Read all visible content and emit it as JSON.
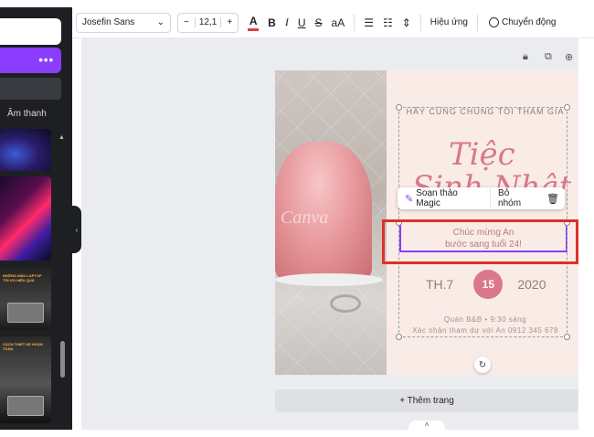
{
  "sidebar": {
    "more_label": "•••",
    "audio_label": "Âm thanh",
    "thumb3_text": "NHỮNG MẪU LAPTOP TỐI ƯU HIỆU QUẢ",
    "thumb4_text": "CÁCH THIẾT KẾ HOÀN TOÀN"
  },
  "toolbar": {
    "font_name": "Josefin Sans",
    "font_size": "12,1",
    "minus": "−",
    "plus": "+",
    "text_color_glyph": "A",
    "bold": "B",
    "italic": "I",
    "underline": "U",
    "strike": "S",
    "case": "aA",
    "effects": "Hiệu ứng",
    "animate": "Chuyển động",
    "text_color": "#e04040"
  },
  "design": {
    "watermark": "Canva",
    "invite_line": "HÃY CÙNG CHÚNG TÔI THAM GIA",
    "title_line1": "Tiệc",
    "title_line2": "Sinh Nhật",
    "congrats_line1": "Chúc mừng An",
    "congrats_line2": "bước sang tuổi 24!",
    "weekday": "TH.7",
    "day": "15",
    "year": "2020",
    "venue": "Quán B&B • 9:30 sáng",
    "rsvp": "Xác nhận tham dự với An 0912 345 678",
    "accent_color": "#d9788a"
  },
  "context_menu": {
    "magic_write": "Soạn thảo Magic",
    "ungroup": "Bỏ nhóm"
  },
  "footer": {
    "add_page": "+ Thêm trang"
  },
  "brand_color": "#8b3dff",
  "highlight_color": "#e0302a"
}
